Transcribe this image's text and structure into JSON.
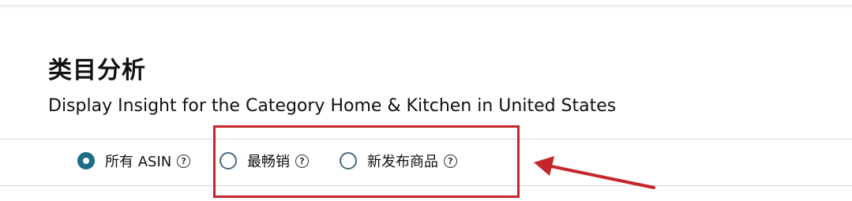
{
  "section": {
    "title": "类目分析",
    "subtitle": "Display Insight for the Category Home & Kitchen in United States"
  },
  "filter_options": [
    {
      "label": "所有 ASIN",
      "selected": true,
      "help_icon": "question-circle-icon"
    },
    {
      "label": "最畅销",
      "selected": false,
      "help_icon": "question-circle-icon"
    },
    {
      "label": "新发布商品",
      "selected": false,
      "help_icon": "question-circle-icon"
    }
  ],
  "help_glyph": "?",
  "annotation": {
    "highlight_color": "#c4262a",
    "arrow_color": "#c4262a",
    "arrow_icon": "arrow-left-icon"
  },
  "colors": {
    "radio_selected": "#1b6d85",
    "text": "#0f1111"
  }
}
